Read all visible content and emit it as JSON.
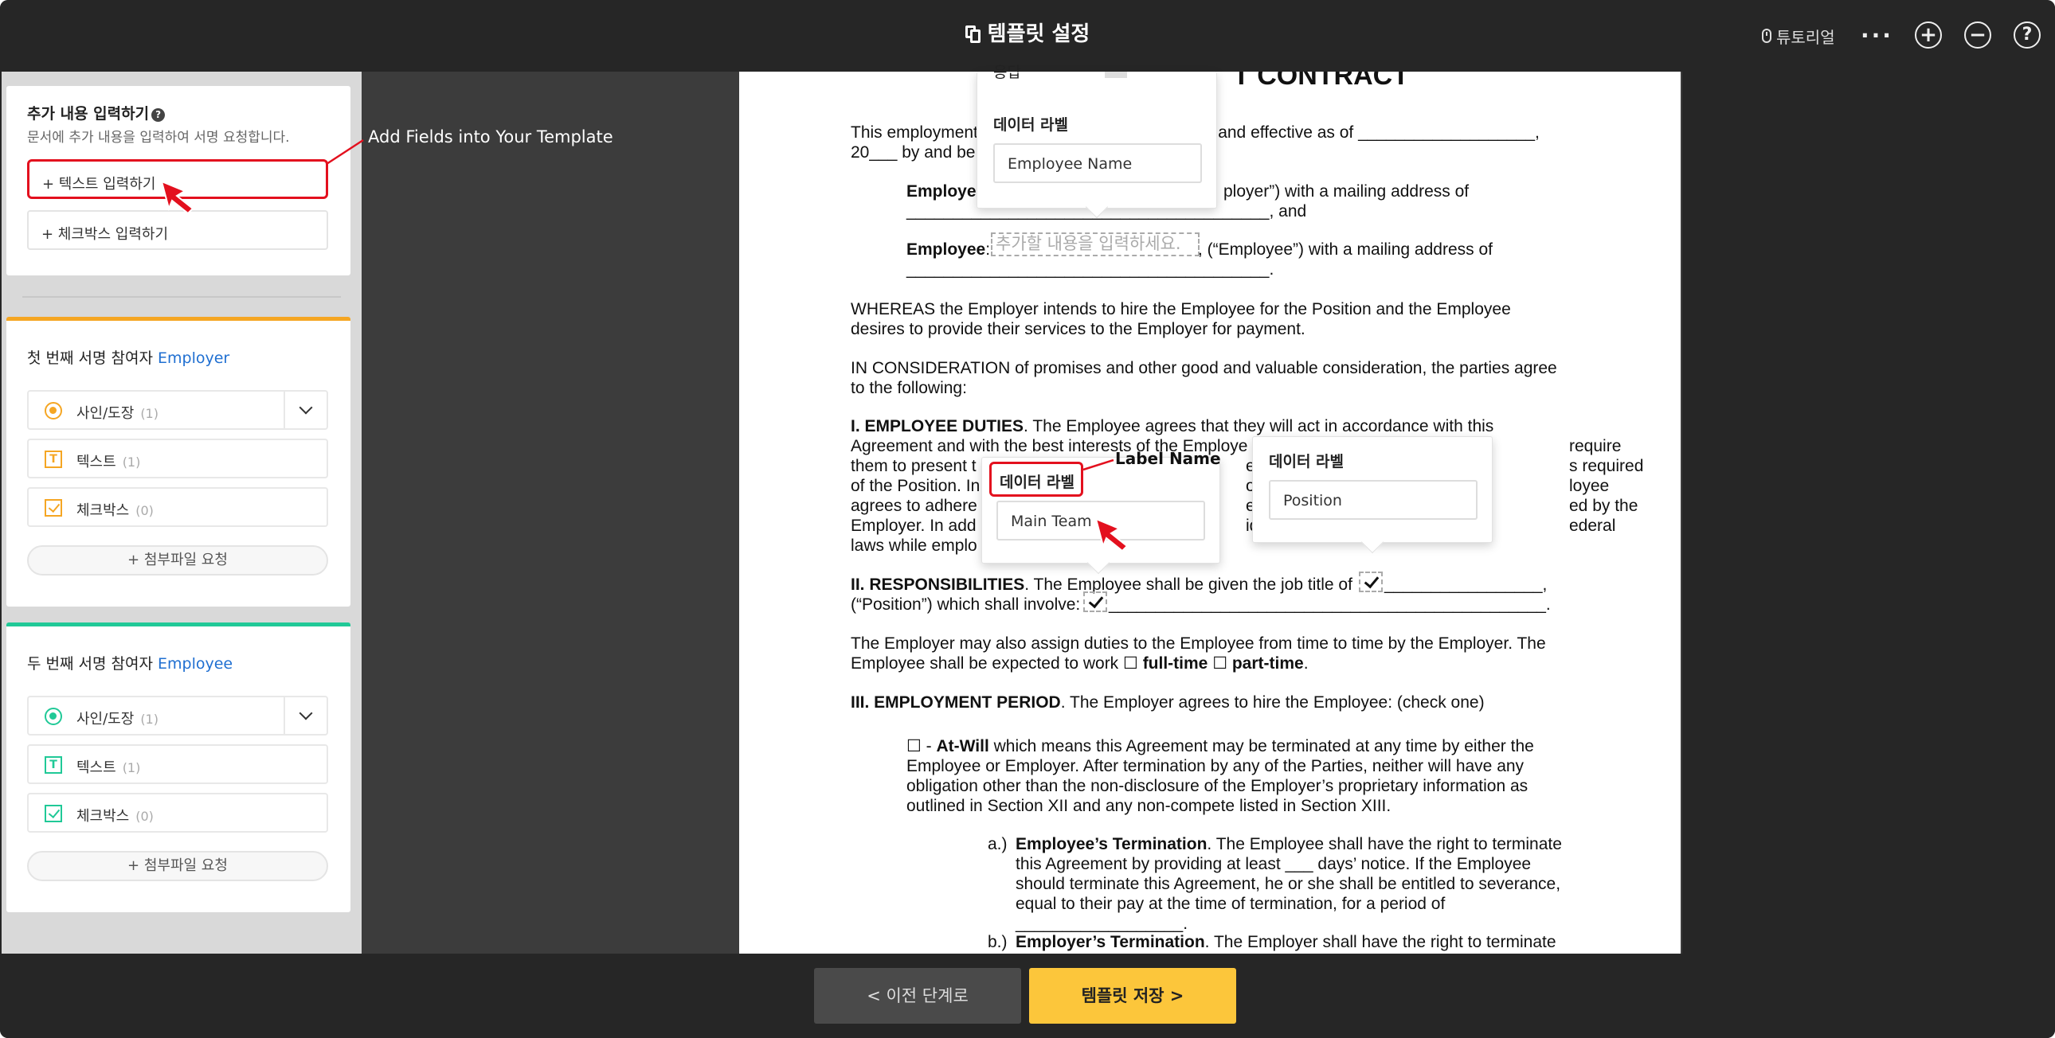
{
  "header": {
    "title": "템플릿 설정",
    "tutorial_label": "튜토리얼",
    "more_label": "···",
    "zoom_in_label": "+",
    "zoom_out_label": "−",
    "help_label": "?"
  },
  "add_content": {
    "title": "추가 내용 입력하기",
    "subtitle": "문서에 추가 내용을 입력하여 서명 요청합니다.",
    "text_button": "+ 텍스트 입력하기",
    "checkbox_button": "+ 체크박스 입력하기",
    "help_label": "?"
  },
  "annotation_add_fields": "Add Fields into Your Template",
  "signers": [
    {
      "title": "첫 번째 서명 참여자",
      "role": "Employer",
      "accent": "#f5a623",
      "fields": [
        {
          "label": "사인/도장",
          "count": "(1)"
        },
        {
          "label": "텍스트",
          "count": "(1)"
        },
        {
          "label": "체크박스",
          "count": "(0)"
        }
      ],
      "attach_label": "+ 첨부파일 요청"
    },
    {
      "title": "두 번째 서명 참여자",
      "role": "Employee",
      "accent": "#20c997",
      "fields": [
        {
          "label": "사인/도장",
          "count": "(1)"
        },
        {
          "label": "텍스트",
          "count": "(1)"
        },
        {
          "label": "체크박스",
          "count": "(0)"
        }
      ],
      "attach_label": "+ 첨부파일 요청"
    }
  ],
  "document": {
    "heading": "T CONTRACT",
    "intro_1": "This employment",
    "intro_1b": "de and effective as of ___________________,",
    "intro_2": "20___ by and be",
    "employer_label": "Employe",
    "employer_rest": "ployer”) with a mailing address of",
    "employer_line": "_______________________________________, and",
    "employee_label": "Employee",
    "employee_colon": ":",
    "employee_rest": ", (“Employee”) with a mailing address of",
    "employee_line": "_______________________________________.",
    "employee_placeholder": "추가할 내용을 입력하세요.",
    "whereas_1": "WHEREAS the Employer intends to hire the Employee for the Position and the Employee",
    "whereas_2": "desires to provide their services to the Employer for payment.",
    "consid_1": "IN CONSIDERATION of promises and other good and valuable consideration, the parties agree",
    "consid_2": "to the following:",
    "duties_head": "I. EMPLOYEE DUTIES",
    "duties_1": ". The Employee agrees that they will act in accordance with this",
    "duties_2": "Agreement and with the best interests of the Employe",
    "duties_2b": "require",
    "duties_3": "them to present t",
    "duties_3b": "e, an",
    "duties_3c": "s required",
    "duties_4": "of the Position. In",
    "duties_4b": "ons",
    "duties_4c": "loyee",
    "duties_5": "agrees to adhere",
    "duties_5b": "es, r",
    "duties_5c": "ed by the",
    "duties_6": "Employer. In add",
    "duties_6b": "ide b",
    "duties_6c": "ederal",
    "duties_7": "laws while emplo",
    "resp_head": "II. RESPONSIBILITIES",
    "resp_1": ". The Employee shall be given the job title of",
    "resp_1b": "_________________,",
    "resp_2": "(“Position”) which shall involve:",
    "resp_2b": "_______________________________________________.",
    "assign_1": "The Employer may also assign duties to the Employee from time to time by the Employer. The",
    "assign_2a": "Employee shall be expected to work ☐ ",
    "assign_2b": "full-time",
    "assign_2c": " ☐ ",
    "assign_2d": "part-time",
    "assign_2e": ".",
    "period_head": "III. EMPLOYMENT PERIOD",
    "period_1": ". The Employer agrees to hire the Employee: (check one)",
    "atwill_a": "☐ - ",
    "atwill_b": "At-Will",
    "atwill_1": " which means this Agreement may be terminated at any time by either the",
    "atwill_2": "Employee or Employer. After termination by any of the Parties, neither will have any",
    "atwill_3": "obligation other than the non-disclosure of the Employer’s proprietary information as",
    "atwill_4": "outlined in Section XII and any non-compete listed in Section XIII.",
    "term_a_idx": "a.)",
    "term_a_head": "Employee’s Termination",
    "term_a_1": ". The Employee shall have the right to terminate",
    "term_a_2": "this Agreement by providing at least ___ days’ notice. If the Employee",
    "term_a_3": "should terminate this Agreement, he or she shall be entitled to severance,",
    "term_a_4": "equal to their pay at the time of termination, for a period of",
    "term_a_5": "__________________.",
    "term_b_idx": "b.)",
    "term_b_head": "Employer’s Termination",
    "term_b_1": ". The Employer shall have the right to terminate"
  },
  "popovers": {
    "top": {
      "partial_label": "응답",
      "label": "데이터 라벨",
      "value": "Employee Name"
    },
    "main_team": {
      "label": "데이터 라벨",
      "value": "Main Team"
    },
    "position": {
      "label": "데이터 라벨",
      "value": "Position"
    }
  },
  "annotation_label_name": "Label Name",
  "footer": {
    "prev_label": "< 이전 단계로",
    "save_label": "템플릿 저장 >"
  },
  "colors": {
    "accent_red": "#e3101e",
    "employer_orange": "#f5a623",
    "employee_teal": "#20c997",
    "save_yellow": "#fcc63b",
    "role_blue": "#1f6fd1"
  }
}
